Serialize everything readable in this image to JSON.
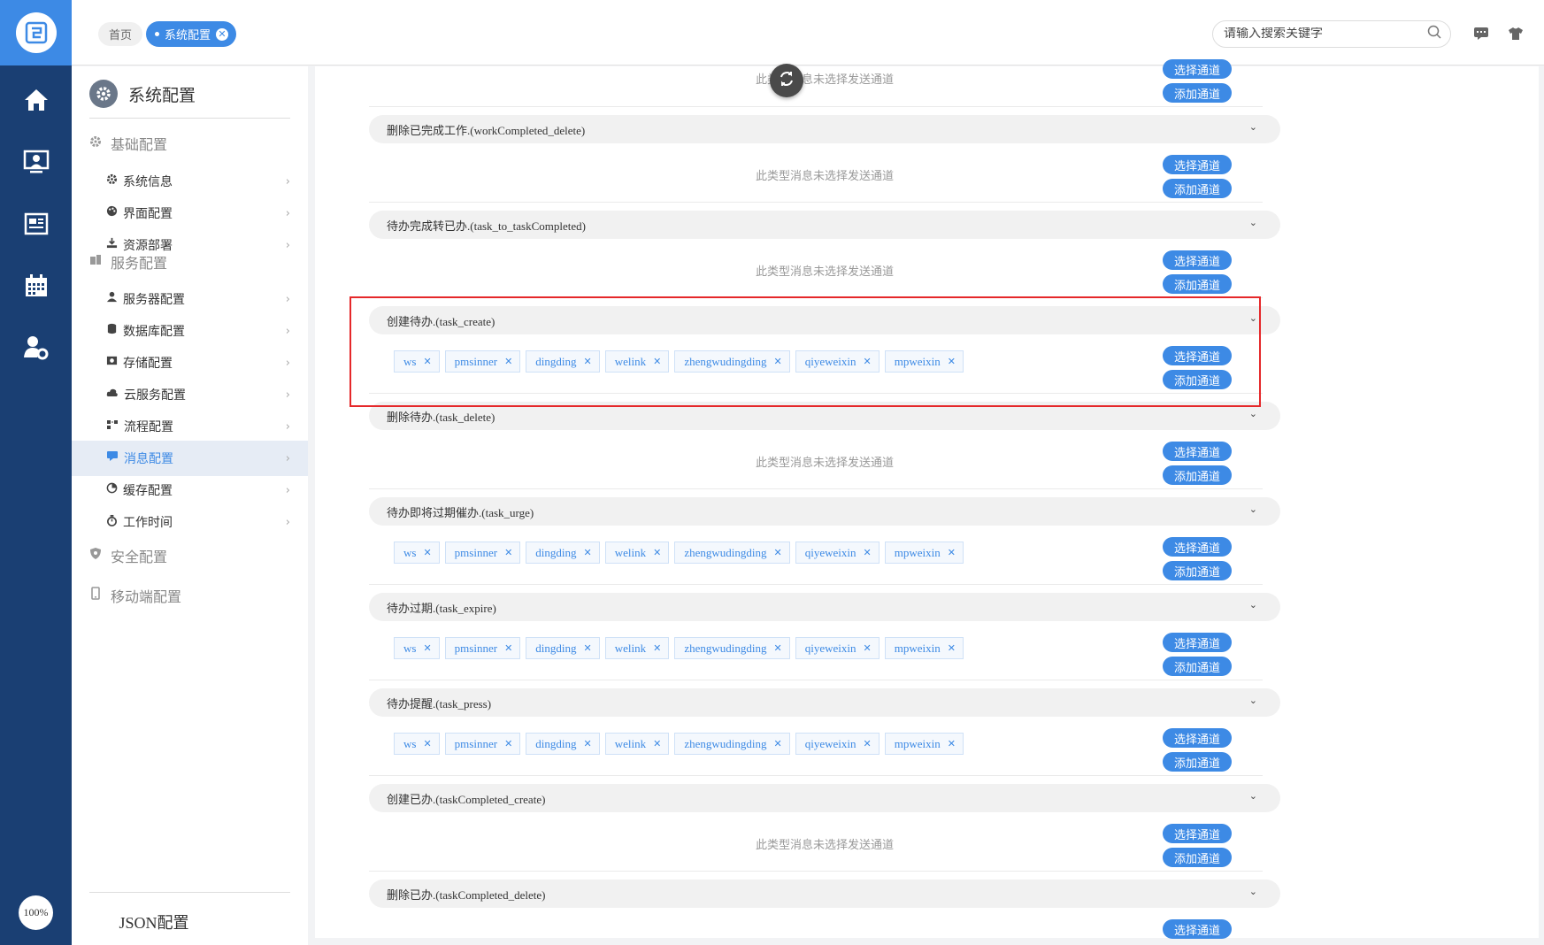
{
  "app": {
    "logo_icon": "app-logo-icon",
    "zoom": "100%"
  },
  "rail": {
    "items": [
      {
        "icon": "home-icon"
      },
      {
        "icon": "monitor-user-icon"
      },
      {
        "icon": "news-icon"
      },
      {
        "icon": "calendar-icon"
      },
      {
        "icon": "user-settings-icon"
      }
    ]
  },
  "topbar": {
    "breadcrumb_home": "首页",
    "active_tab": "系统配置",
    "search_placeholder": "请输入搜索关键字",
    "icons": [
      "message-icon",
      "shirt-icon"
    ]
  },
  "sidebar": {
    "title": "系统配置",
    "groups": [
      {
        "label": "基础配置",
        "icon": "gear-icon"
      },
      {
        "label": "服务配置",
        "icon": "server-icon"
      },
      {
        "label": "安全配置",
        "icon": "shield-icon"
      },
      {
        "label": "移动端配置",
        "icon": "mobile-icon"
      }
    ],
    "items": [
      {
        "label": "系统信息",
        "icon": "gear-icon"
      },
      {
        "label": "界面配置",
        "icon": "palette-icon"
      },
      {
        "label": "资源部署",
        "icon": "deploy-icon"
      },
      {
        "label": "服务器配置",
        "icon": "server-user-icon"
      },
      {
        "label": "数据库配置",
        "icon": "database-icon"
      },
      {
        "label": "存储配置",
        "icon": "storage-icon"
      },
      {
        "label": "云服务配置",
        "icon": "cloud-icon"
      },
      {
        "label": "流程配置",
        "icon": "flow-icon"
      },
      {
        "label": "消息配置",
        "icon": "message-config-icon"
      },
      {
        "label": "缓存配置",
        "icon": "pie-icon"
      },
      {
        "label": "工作时间",
        "icon": "stopwatch-icon"
      }
    ],
    "json_config": "JSON配置"
  },
  "main": {
    "empty_text": "此类型消息未选择发送通道",
    "select_btn": "选择通道",
    "add_btn": "添加通道",
    "channels": [
      "ws",
      "pmsinner",
      "dingding",
      "welink",
      "zhengwudingding",
      "qiyeweixin",
      "mpweixin"
    ],
    "categories": [
      {
        "title": "删除已完成工作.(workCompleted_delete)",
        "has_channels": false
      },
      {
        "title": "待办完成转已办.(task_to_taskCompleted)",
        "has_channels": false
      },
      {
        "title": "创建待办.(task_create)",
        "has_channels": true
      },
      {
        "title": "删除待办.(task_delete)",
        "has_channels": false
      },
      {
        "title": "待办即将过期催办.(task_urge)",
        "has_channels": true
      },
      {
        "title": "待办过期.(task_expire)",
        "has_channels": true
      },
      {
        "title": "待办提醒.(task_press)",
        "has_channels": true
      },
      {
        "title": "创建已办.(taskCompleted_create)",
        "has_channels": false
      },
      {
        "title": "删除已办.(taskCompleted_delete)",
        "has_channels": false
      }
    ]
  },
  "colors": {
    "accent": "#3d8ae5",
    "rail": "#1a3f73",
    "highlight": "#e5282a"
  }
}
